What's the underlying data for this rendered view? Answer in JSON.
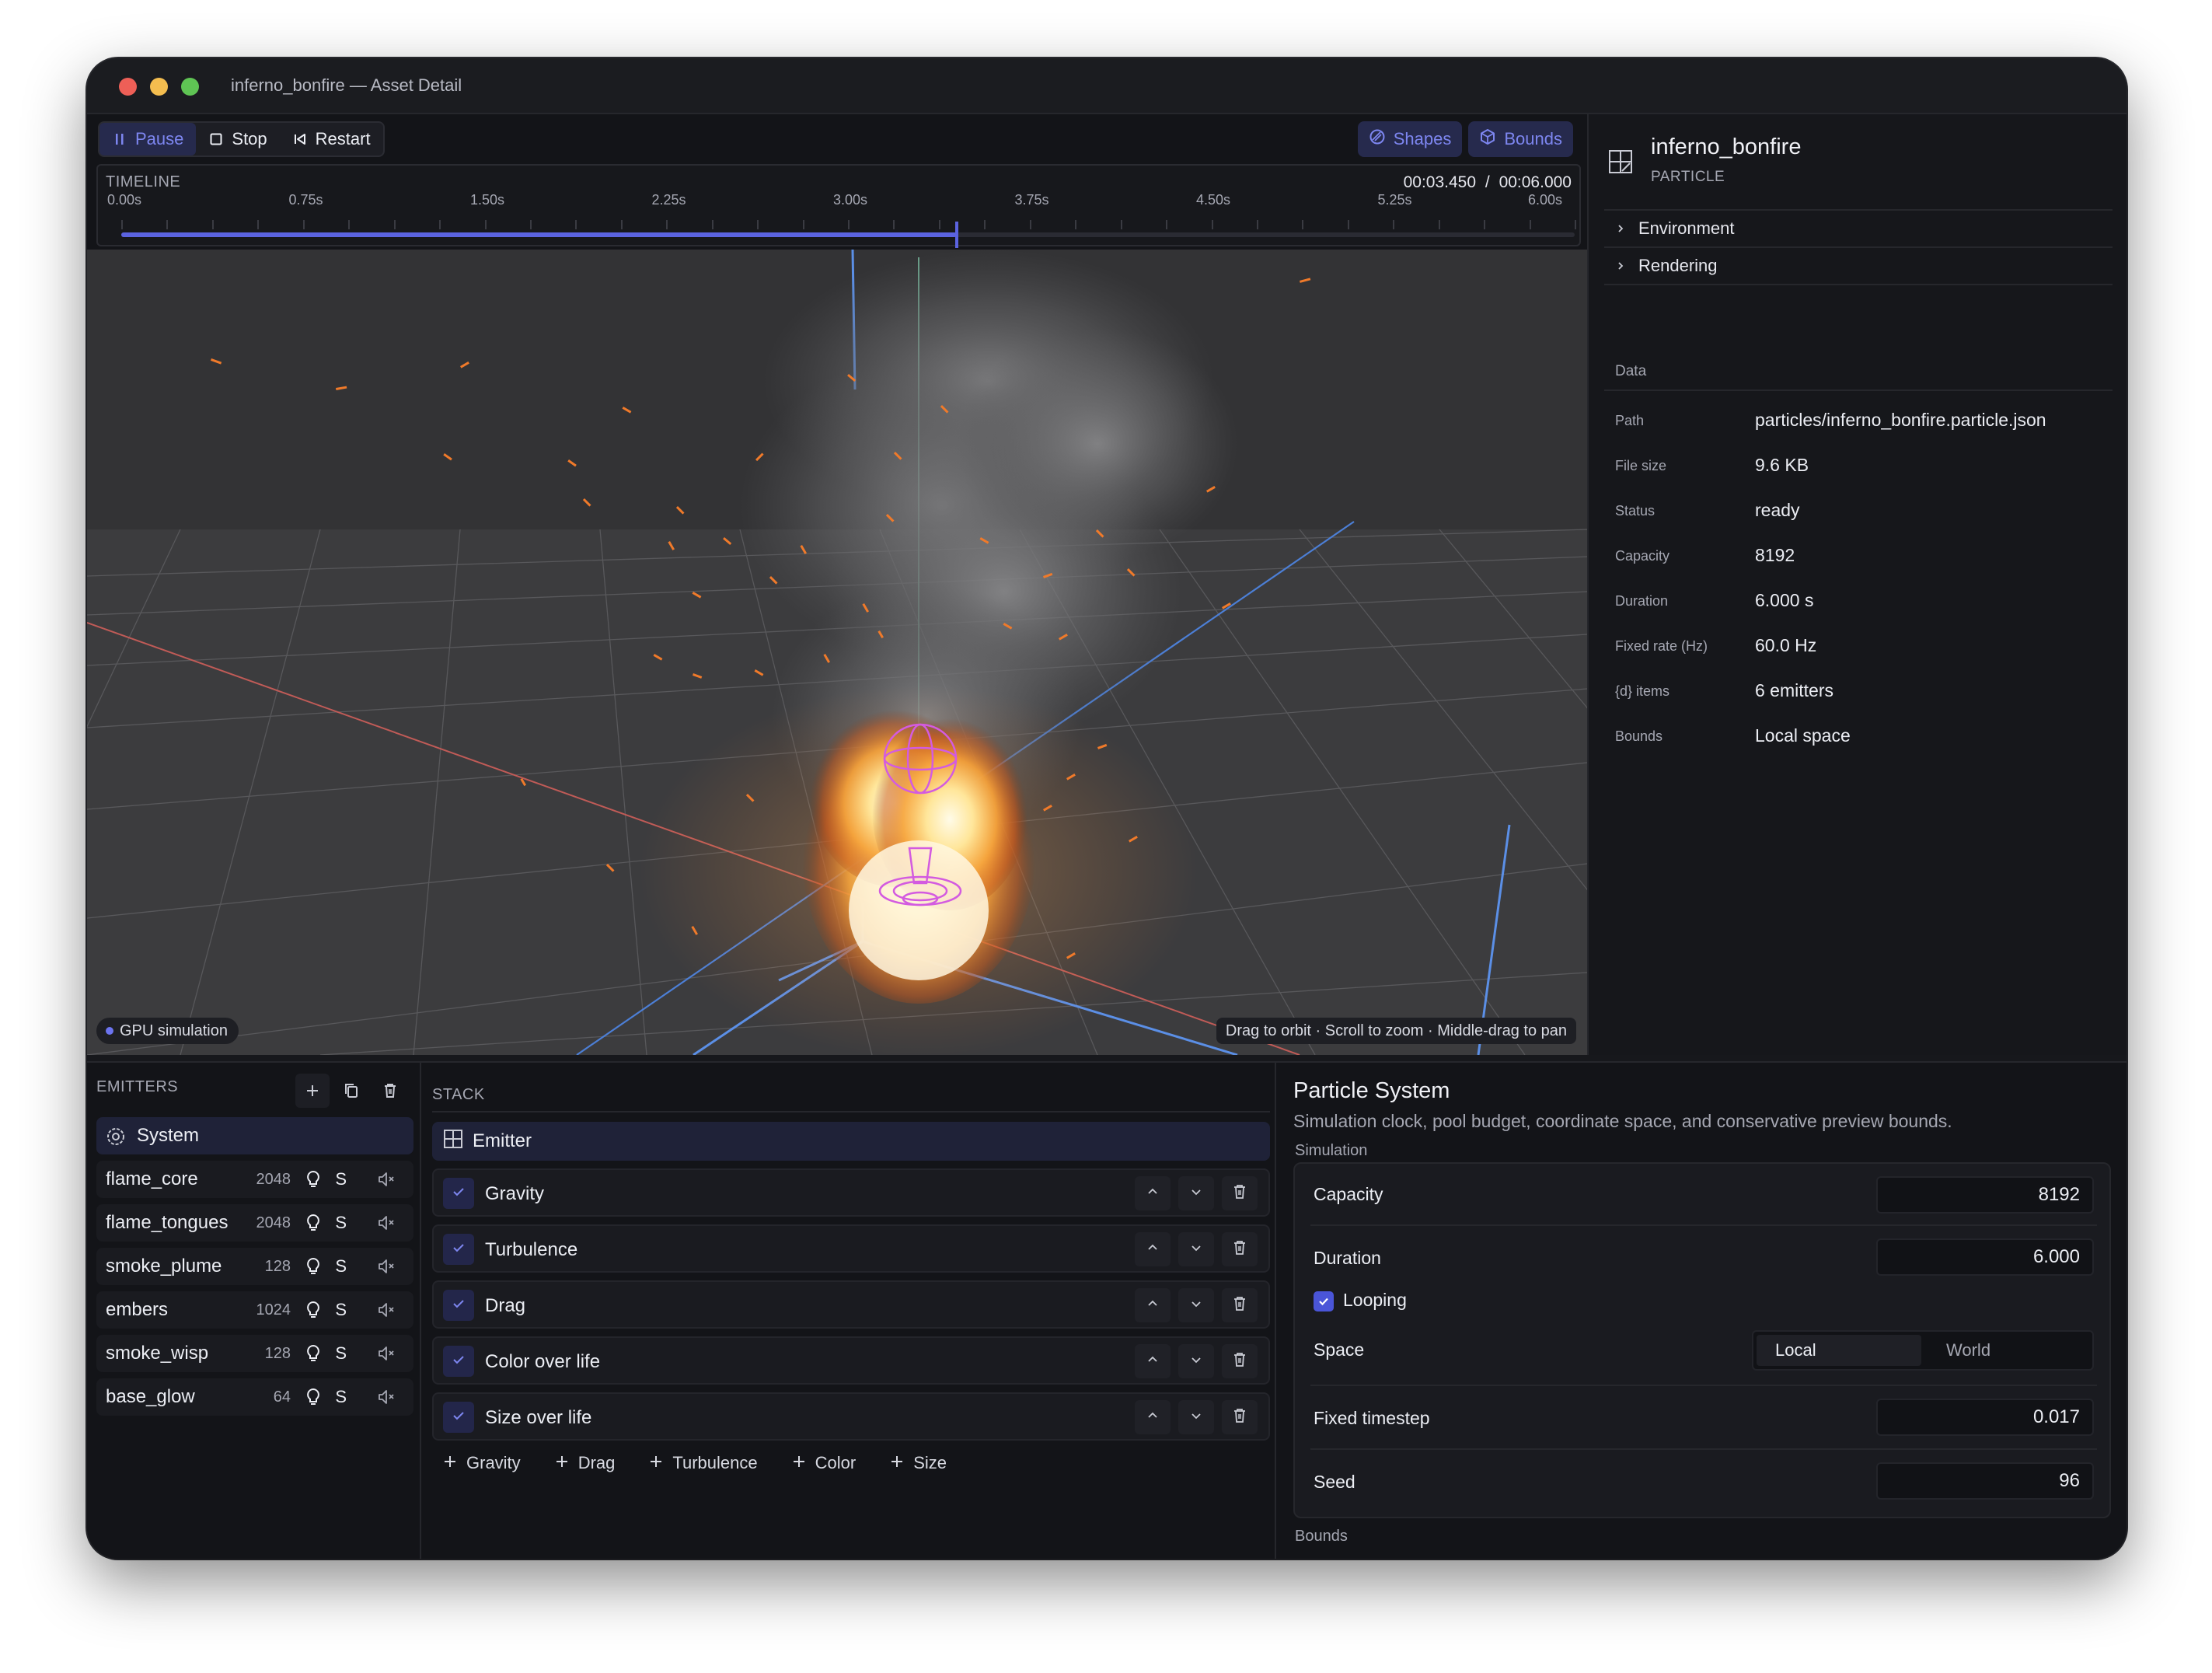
{
  "window": {
    "title": "inferno_bonfire — Asset Detail"
  },
  "toolbar": {
    "pause_label": "Pause",
    "stop_label": "Stop",
    "restart_label": "Restart",
    "shapes_label": "Shapes",
    "bounds_label": "Bounds"
  },
  "timeline": {
    "label": "TIMELINE",
    "current": "00:03.450",
    "separator": "/",
    "total": "00:06.000",
    "ticks": [
      "0.00s",
      "0.75s",
      "1.50s",
      "2.25s",
      "3.00s",
      "3.75s",
      "4.50s",
      "5.25s",
      "6.00s"
    ],
    "progress": 0.575
  },
  "viewport": {
    "badge": "GPU simulation",
    "hint": "Drag to orbit · Scroll to zoom · Middle-drag to pan"
  },
  "asset": {
    "name": "inferno_bonfire",
    "type": "PARTICLE",
    "sections": [
      "Environment",
      "Rendering"
    ],
    "data_label": "Data",
    "fields": [
      {
        "k": "Path",
        "v": "particles/inferno_bonfire.particle.json"
      },
      {
        "k": "File size",
        "v": "9.6 KB"
      },
      {
        "k": "Status",
        "v": "ready"
      },
      {
        "k": "Capacity",
        "v": "8192"
      },
      {
        "k": "Duration",
        "v": "6.000 s"
      },
      {
        "k": "Fixed rate (Hz)",
        "v": "60.0 Hz"
      },
      {
        "k": "{d} items",
        "v": "6 emitters"
      },
      {
        "k": "Bounds",
        "v": "Local space"
      }
    ]
  },
  "emitters": {
    "label": "EMITTERS",
    "system_label": "System",
    "solo_label": "S",
    "items": [
      {
        "name": "flame_core",
        "count": "2048"
      },
      {
        "name": "flame_tongues",
        "count": "2048"
      },
      {
        "name": "smoke_plume",
        "count": "128"
      },
      {
        "name": "embers",
        "count": "1024"
      },
      {
        "name": "smoke_wisp",
        "count": "128"
      },
      {
        "name": "base_glow",
        "count": "64"
      }
    ]
  },
  "stack": {
    "label": "STACK",
    "emitter_label": "Emitter",
    "modules": [
      "Gravity",
      "Turbulence",
      "Drag",
      "Color over life",
      "Size over life"
    ],
    "add": [
      "Gravity",
      "Drag",
      "Turbulence",
      "Color",
      "Size"
    ]
  },
  "props": {
    "title": "Particle System",
    "subtitle": "Simulation clock, pool budget, coordinate space, and conservative preview bounds.",
    "simulation_label": "Simulation",
    "bounds_label": "Bounds",
    "capacity_label": "Capacity",
    "capacity_value": "8192",
    "duration_label": "Duration",
    "duration_value": "6.000",
    "looping_label": "Looping",
    "space_label": "Space",
    "space_local": "Local",
    "space_world": "World",
    "timestep_label": "Fixed timestep",
    "timestep_value": "0.017",
    "seed_label": "Seed",
    "seed_value": "96"
  },
  "colors": {
    "accent": "#5b63e0",
    "accent_text": "#7d86f0",
    "panel": "#16171b"
  }
}
